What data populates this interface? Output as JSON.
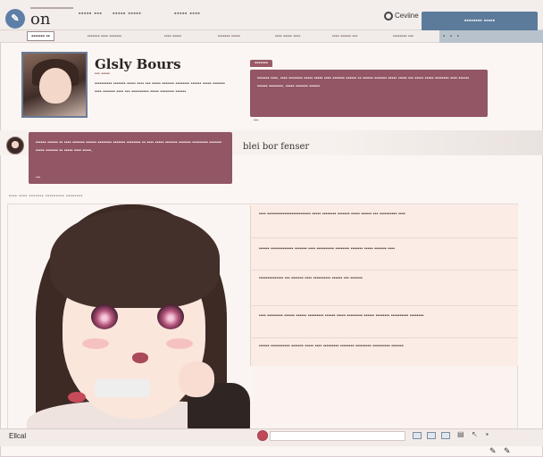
{
  "header": {
    "app_name": "on",
    "nav": [
      "▪▪▪▪▪ ▪▪▪",
      "▪▪▪▪▪ ▪▪▪▪▪",
      "▪▪▪▪▪ ▪▪▪▪"
    ],
    "search_label": "Ceviine",
    "account_button": "▪▪▪▪▪▪▪▪ ▪▪▪▪▪"
  },
  "subbar": {
    "breadcrumb": "▪▪▪▪▪▪▪ ▪▪",
    "links": [
      "▪▪▪▪▪▪▪ ▪▪▪▪ ▪▪▪▪▪▪▪",
      "▪▪▪▪ ▪▪▪▪▪",
      "▪▪▪▪▪▪▪ ▪▪▪▪▪",
      "▪▪▪▪ ▪▪▪▪▪ ▪▪▪▪",
      "▪▪▪▪ ▪▪▪▪▪▪ ▪▪▪",
      "▪▪▪▪▪▪▪▪ ▪▪▪"
    ],
    "icons": "▪ ▪ ▪"
  },
  "profile": {
    "name": "Glsly Bours",
    "handle": "▪▪▪ ▪▪▪▪▪",
    "bio": "▪▪▪▪▪▪▪▪▪▪ ▪▪▪▪▪▪▪ ▪▪▪▪▪ ▪▪▪▪ ▪▪▪ ▪▪▪▪▪ ▪▪▪▪▪▪▪ ▪▪▪▪▪▪▪▪ ▪▪▪▪▪▪ ▪▪▪▪▪ ▪▪▪▪▪▪▪ ▪▪▪▪ ▪▪▪▪▪▪▪ ▪▪▪▪ ▪▪▪ ▪▪▪▪▪▪▪▪▪▪ ▪▪▪▪▪ ▪▪▪▪▪▪▪▪ ▪▪▪▪▪▪"
  },
  "comment_right": {
    "tag": "▪▪▪▪▪▪▪",
    "body": "▪▪▪▪▪▪▪ ▪▪▪▪. ▪▪▪▪ ▪▪▪▪▪▪▪▪ ▪▪▪▪▪ ▪▪▪▪▪ ▪▪▪▪ ▪▪▪▪▪▪▪ ▪▪▪▪▪▪ ▪▪ ▪▪▪▪▪▪ ▪▪▪▪▪▪▪ ▪▪▪▪▪ ▪▪▪▪▪ ▪▪▪ ▪▪▪▪▪ ▪▪▪▪▪ ▪▪▪▪▪▪▪▪ ▪▪▪▪ ▪▪▪▪▪▪ ▪▪▪▪▪▪ ▪▪▪▪▪▪▪▪. ▪▪▪▪▪ ▪▪▪▪▪▪▪ ▪▪▪▪▪▪",
    "footer": "▪▪▪"
  },
  "comment_left": {
    "body": "▪▪▪▪▪▪ ▪▪▪▪▪▪ ▪▪ ▪▪▪▪ ▪▪▪▪▪▪▪ ▪▪▪▪▪▪ ▪▪▪▪▪▪▪▪ ▪▪▪▪▪▪▪ ▪▪▪▪▪▪▪▪ ▪▪ ▪▪▪▪ ▪▪▪▪▪ ▪▪▪▪▪▪▪ ▪▪▪▪▪▪▪ ▪▪▪▪▪▪▪▪▪ ▪▪▪▪▪▪▪ ▪▪▪▪▪ ▪▪▪▪▪▪▪ ▪▪ ▪▪▪▪▪ ▪▪▪▪ ▪▪▪▪▪.",
    "footer": "▪▪▪"
  },
  "section": {
    "heading": "blei bor fenser",
    "divider_note": "▪▪▪▪ ▪▪▪▪ ▪▪▪▪▪▪▪ ▪▪▪▪▪▪▪▪▪ ▪▪▪▪▪▪▪▪"
  },
  "notes": [
    "▪▪▪▪ ▪▪▪▪▪▪▪▪▪▪▪▪▪▪▪▪▪▪▪▪▪▪▪▪▪ ▪▪▪▪▪ ▪▪▪▪▪▪▪▪ ▪▪▪▪▪▪▪ ▪▪▪▪▪ ▪▪▪▪▪▪ ▪▪▪ ▪▪▪▪▪▪▪▪▪▪ ▪▪▪▪",
    "▪▪▪▪▪▪ ▪▪▪▪▪▪▪▪▪▪▪▪▪ ▪▪▪▪▪▪▪ ▪▪▪▪ ▪▪▪▪▪▪▪▪▪▪ ▪▪▪▪▪▪▪▪ ▪▪▪▪▪▪▪ ▪▪▪▪▪ ▪▪▪▪▪▪▪ ▪▪▪▪",
    "▪▪▪▪▪▪▪▪▪▪▪▪▪▪ ▪▪▪ ▪▪▪▪▪▪▪ ▪▪▪▪ ▪▪▪▪▪▪▪▪▪▪ ▪▪▪▪▪▪ ▪▪▪ ▪▪▪▪▪▪▪",
    "▪▪▪▪ ▪▪▪▪▪▪▪▪▪ ▪▪▪▪▪▪ ▪▪▪▪▪▪ ▪▪▪▪▪▪▪▪▪ ▪▪▪▪▪▪ ▪▪▪▪▪ ▪▪▪▪▪▪▪▪▪ ▪▪▪▪▪▪ ▪▪▪▪▪▪▪▪ ▪▪▪▪▪▪▪▪▪▪ ▪▪▪▪▪▪▪▪",
    "▪▪▪▪▪▪ ▪▪▪▪▪▪▪▪▪▪▪ ▪▪▪▪▪▪▪ ▪▪▪▪▪ ▪▪▪▪ ▪▪▪▪▪▪▪▪▪ ▪▪▪▪▪▪▪▪ ▪▪▪▪▪▪▪▪▪ ▪▪▪▪▪▪▪▪▪▪ ▪▪▪▪▪▪▪"
  ],
  "bottombar": {
    "label": "Ellcal",
    "tool_glyphs": [
      "▤",
      "↖",
      "▪"
    ],
    "pen_icons": "✎ ✎"
  },
  "colors": {
    "accent": "#925664",
    "nav_blue": "#5c7b9a",
    "record": "#c24a58"
  }
}
